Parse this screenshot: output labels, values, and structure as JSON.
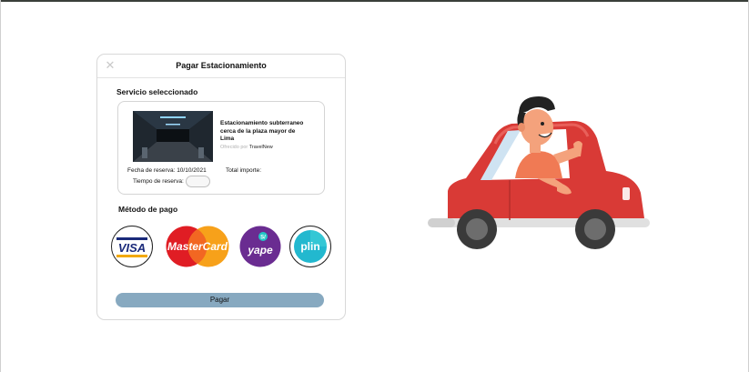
{
  "modal": {
    "title": "Pagar Estacionamiento",
    "close_icon": "close-icon"
  },
  "service": {
    "section_title": "Servicio seleccionado",
    "description": "Estacionamiento subterraneo cerca de la plaza mayor de Lima",
    "offered_by_label": "Ofrecido por",
    "offered_by_name": "TravelNew",
    "fecha_label": "Fecha de reserva: 10/10/2021",
    "total_label": "Total importe:",
    "tiempo_label": "Tiempo de reserva:"
  },
  "payment": {
    "section_title": "Método de pago",
    "methods": [
      {
        "name": "VISA",
        "icon": "visa-icon"
      },
      {
        "name": "MasterCard",
        "icon": "mastercard-icon"
      },
      {
        "name": "yape",
        "icon": "yape-icon"
      },
      {
        "name": "plin",
        "icon": "plin-icon"
      }
    ],
    "button_label": "Pagar"
  },
  "colors": {
    "pay_button": "#87a9c0",
    "car_red": "#d93a36",
    "yape_purple": "#6a2c91",
    "plin_teal": "#22b8cf"
  }
}
